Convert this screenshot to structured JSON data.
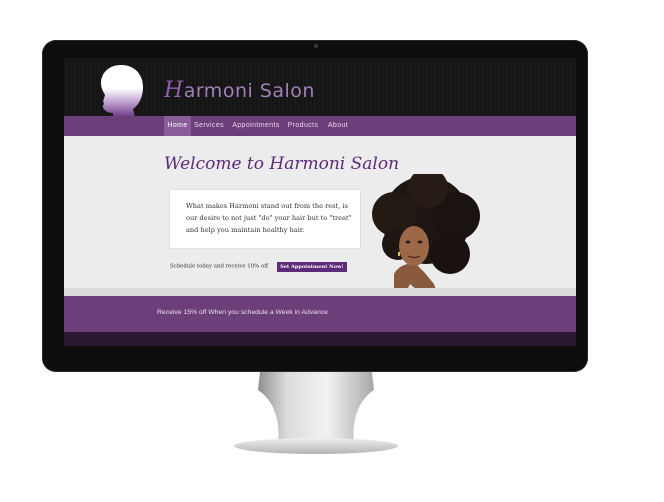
{
  "site": {
    "title_initial": "H",
    "title_rest": "armoni Salon"
  },
  "nav": {
    "items": [
      {
        "label": "Home"
      },
      {
        "label": "Services"
      },
      {
        "label": "Appointments"
      },
      {
        "label": "Products"
      },
      {
        "label": "About"
      }
    ],
    "active": "Home"
  },
  "main": {
    "heading": "Welcome to Harmoni Salon",
    "quote": "What makes Harmoni stand out from the rest, is our desire to not just \"do\" your hair but to \"treat\" and help you maintain healthy hair.",
    "schedule_text": "Schedule today and receive 10% off",
    "appointment_button": "Set Appointment Now!"
  },
  "promo": {
    "text": "Receive 15% off When you schedule a Week in Advance"
  },
  "colors": {
    "brand_purple": "#6c3f7a",
    "heading_purple": "#5b2a78",
    "logo_purple": "#a27fb8"
  },
  "icons": {
    "logo": "afro-silhouette-logo",
    "portrait": "woman-portrait-image"
  }
}
